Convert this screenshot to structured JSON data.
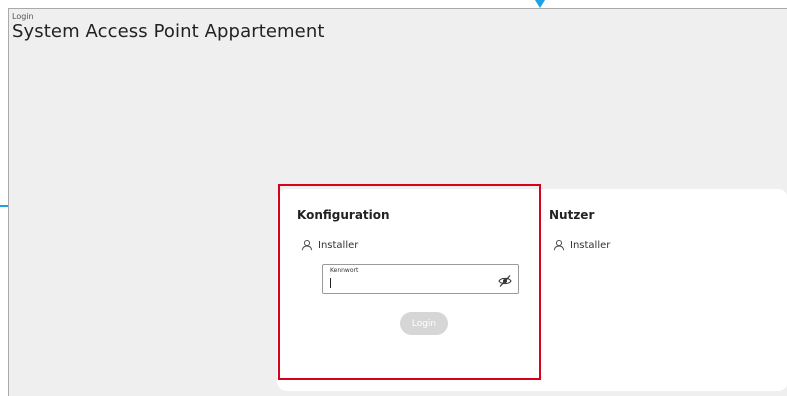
{
  "header": {
    "breadcrumb": "Login",
    "title": "System Access Point Appartement"
  },
  "config_section": {
    "title": "Konfiguration",
    "user_icon": "user-icon",
    "user_label": "Installer",
    "password": {
      "label": "Kennwort",
      "value": "",
      "toggle_icon": "eye-slash-icon"
    },
    "login_button": "Login"
  },
  "user_section": {
    "title": "Nutzer",
    "user_icon": "user-icon",
    "user_label": "Installer"
  },
  "colors": {
    "background": "#efefef",
    "panel": "#ffffff",
    "highlight": "#d9001b",
    "indicator": "#1aa3e8",
    "button_disabled": "#d6d6d6"
  }
}
